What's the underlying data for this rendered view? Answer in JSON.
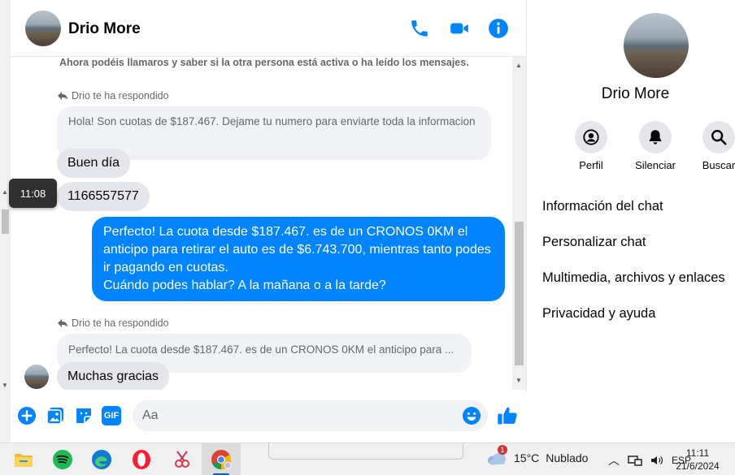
{
  "header": {
    "contact_name": "Drio More",
    "icons": [
      "phone-icon",
      "video-camera-icon",
      "info-icon"
    ]
  },
  "messages": {
    "notice": "Ahora podéis llamaros y saber si la otra persona está activa o ha leído los mensajes.",
    "reply_label_1": "Drio te ha respondido",
    "quoted_1": "Hola! Son cuotas de $187.467. Dejame tu numero para enviarte toda la informacion",
    "incoming_1": "Buen día",
    "tooltip_time": "11:08",
    "incoming_2": "1166557577",
    "outgoing_1": "Perfecto! La cuota desde $187.467. es de un CRONOS 0KM el anticipo para retirar el auto es de $6.743.700, mientras tanto podes ir pagando en cuotas.\nCuándo podes hablar? A la mañana o a la tarde?",
    "reply_label_2": "Drio te ha respondido",
    "quoted_2": "Perfecto! La cuota desde $187.467. es de un CRONOS 0KM el anticipo para ...",
    "incoming_3": "Muchas gracias"
  },
  "composer": {
    "placeholder": "Aa",
    "icons": [
      "plus-icon",
      "image-icon",
      "sticker-icon",
      "gif-icon",
      "emoji-icon",
      "thumbs-up-icon"
    ],
    "gif_text": "GIF"
  },
  "info_panel": {
    "name": "Drio More",
    "actions": [
      {
        "label": "Perfil",
        "icon": "profile-icon"
      },
      {
        "label": "Silenciar",
        "icon": "bell-icon"
      },
      {
        "label": "Buscar",
        "icon": "search-icon"
      }
    ],
    "menu": [
      "Información del chat",
      "Personalizar chat",
      "Multimedia, archivos y enlaces",
      "Privacidad y ayuda"
    ]
  },
  "taskbar": {
    "apps": [
      "file-explorer-icon",
      "spotify-icon",
      "edge-icon",
      "opera-icon",
      "snipping-tool-icon",
      "chrome-icon"
    ],
    "weather_badge": "1",
    "temperature": "15°C",
    "weather": "Nublado",
    "language": "ESP",
    "time": "11:11",
    "date": "21/6/2024"
  },
  "colors": {
    "accent": "#0084ff",
    "incoming_bubble": "#e4e6eb",
    "quoted_bubble": "#f0f2f5"
  }
}
